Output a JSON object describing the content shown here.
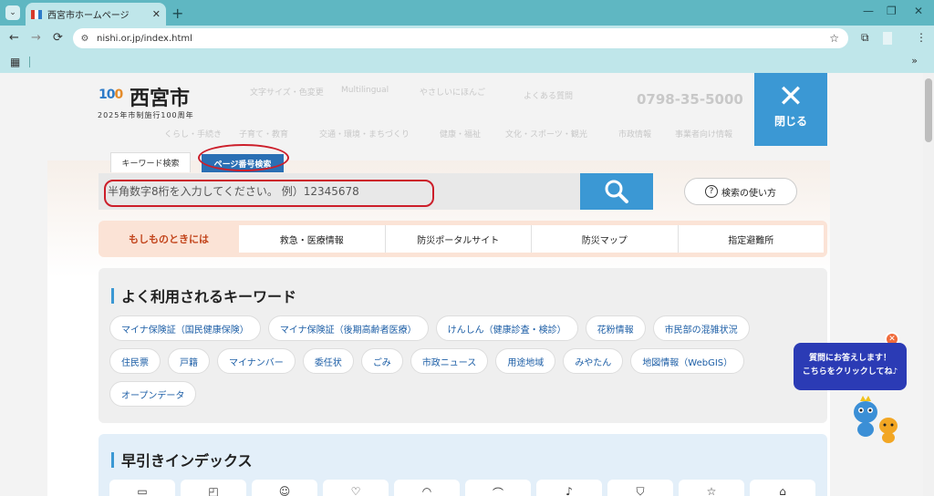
{
  "browser": {
    "tab_title": "西宮市ホームページ",
    "tab_close": "✕",
    "new_tab": "+",
    "url": "nishi.or.jp/index.html",
    "menu_icon": "⌄",
    "back": "←",
    "forward": "→",
    "reload": "⟳",
    "star": "☆",
    "win_min": "—",
    "win_max": "❐",
    "win_close": "✕",
    "bookmark_more": "»",
    "apps": "▦"
  },
  "header": {
    "logo_mark_left": "10",
    "logo_mark_right": "0",
    "title": "西宮市",
    "subtitle": "2025年市制施行100周年",
    "ghost_links": [
      "文字サイズ・色変更",
      "Multilingual",
      "やさしいにほんご"
    ],
    "ghost_faq": "よくある質問",
    "ghost_phone": "0798-35-5000",
    "ghost_nav": [
      "くらし・手続き",
      "子育て・教育",
      "交通・環境・まちづくり",
      "健康・福祉",
      "文化・スポーツ・観光",
      "市政情報",
      "事業者向け情報"
    ],
    "close_label": "閉じる",
    "close_icon": "✕"
  },
  "search": {
    "tab_keyword": "キーワード検索",
    "tab_pagenum": "ページ番号検索",
    "placeholder": "半角数字8桁を入力してください。 例）12345678",
    "howto_label": "検索の使い方",
    "howto_icon": "?"
  },
  "emergency": {
    "title": "もしものときには",
    "links": [
      "救急・医療情報",
      "防災ポータルサイト",
      "防災マップ",
      "指定避難所"
    ]
  },
  "keywords": {
    "title": "よく利用されるキーワード",
    "chips": [
      "マイナ保険証（国民健康保険）",
      "マイナ保険証（後期高齢者医療）",
      "けんしん（健康診査・検診）",
      "花粉情報",
      "市民部の混雑状況",
      "住民票",
      "戸籍",
      "マイナンバー",
      "委任状",
      "ごみ",
      "市政ニュース",
      "用途地域",
      "みやたん",
      "地図情報（WebGIS）",
      "オープンデータ"
    ]
  },
  "index": {
    "title": "早引きインデックス"
  },
  "chat": {
    "line1": "質問にお答えします！",
    "line2": "こちらをクリックしてね♪",
    "close": "✕"
  },
  "colors": {
    "accent": "#3b98d4",
    "annotation": "#cc1e2a",
    "emergency": "#c2441b"
  }
}
